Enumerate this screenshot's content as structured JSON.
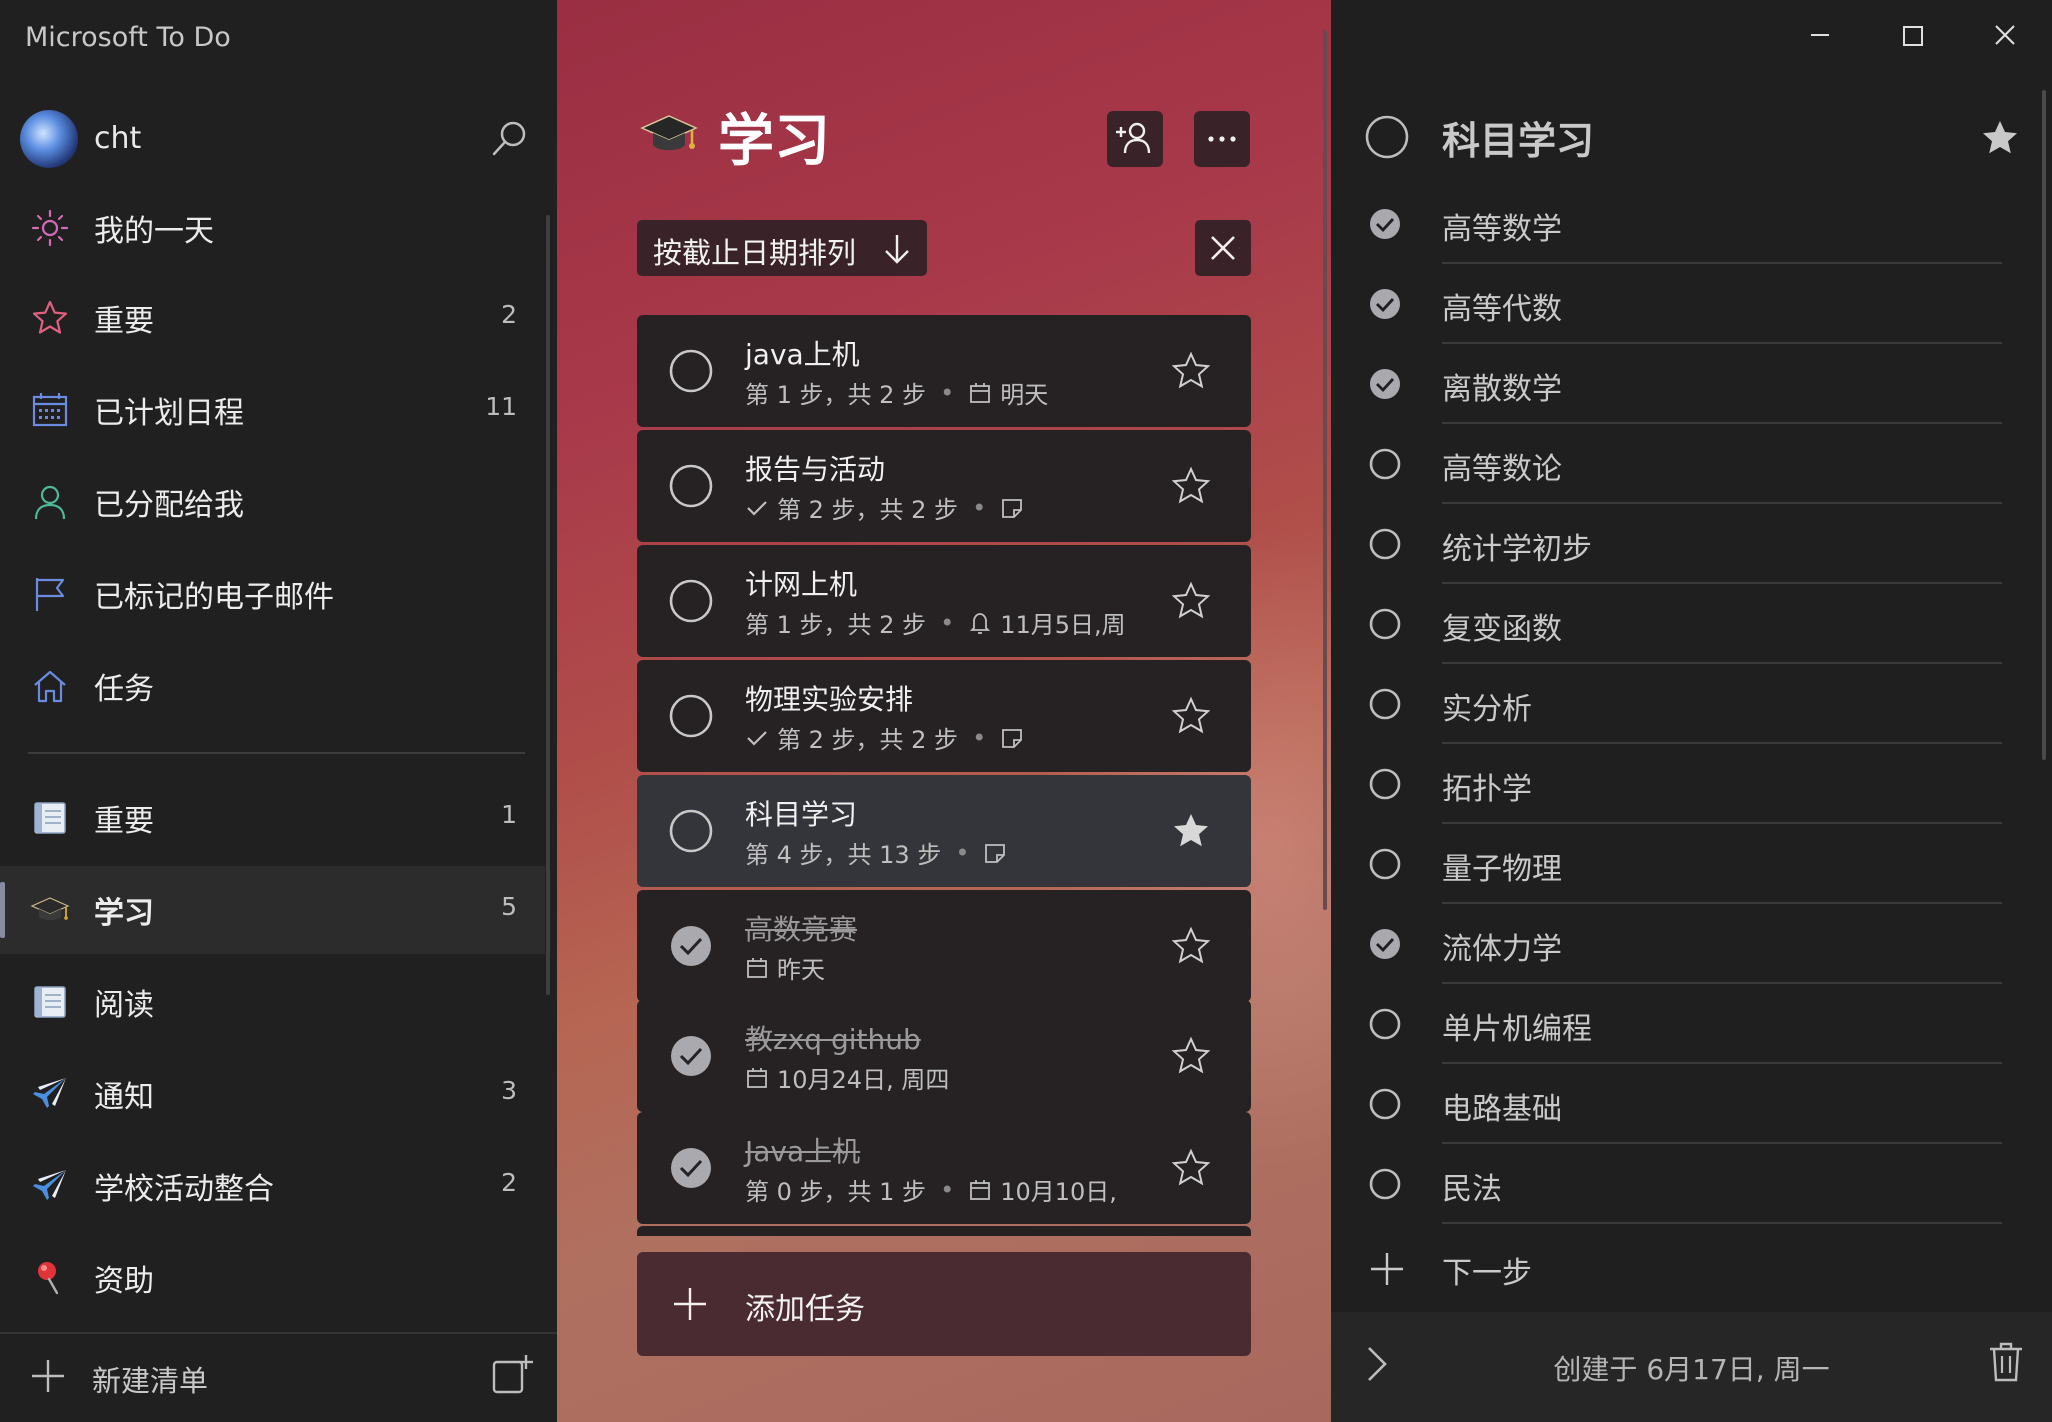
{
  "app_title": "Microsoft To Do",
  "user": {
    "name": "cht"
  },
  "nav": {
    "smart_lists": [
      {
        "label": "我的一天",
        "count": "",
        "icon": "sun-icon"
      },
      {
        "label": "重要",
        "count": "2",
        "icon": "star-outline-icon"
      },
      {
        "label": "已计划日程",
        "count": "11",
        "icon": "calendar-grid-icon"
      },
      {
        "label": "已分配给我",
        "count": "",
        "icon": "person-icon"
      },
      {
        "label": "已标记的电子邮件",
        "count": "",
        "icon": "flag-icon"
      },
      {
        "label": "任务",
        "count": "",
        "icon": "home-icon"
      }
    ],
    "custom_lists": [
      {
        "label": "重要",
        "count": "1",
        "icon": "notebook-icon"
      },
      {
        "label": "学习",
        "count": "5",
        "icon": "graduation-cap-icon",
        "active": true
      },
      {
        "label": "阅读",
        "count": "",
        "icon": "notebook-icon"
      },
      {
        "label": "通知",
        "count": "3",
        "icon": "airplane-icon"
      },
      {
        "label": "学校活动整合",
        "count": "2",
        "icon": "airplane-icon"
      },
      {
        "label": "资助",
        "count": "",
        "icon": "pushpin-icon"
      }
    ],
    "new_list_label": "新建清单"
  },
  "list": {
    "title": "学习",
    "sort_label": "按截止日期排列",
    "add_task_label": "添加任务",
    "tasks": [
      {
        "name": "java上机",
        "done": false,
        "starred": false,
        "steps": "第 1 步，共 2 步",
        "steps_checked": false,
        "extra_icon": "calendar-icon",
        "extra_text": "明天"
      },
      {
        "name": "报告与活动",
        "done": false,
        "starred": false,
        "steps": "第 2 步，共 2 步",
        "steps_checked": true,
        "extra_icon": "note-icon",
        "extra_text": ""
      },
      {
        "name": "计网上机",
        "done": false,
        "starred": false,
        "steps": "第 1 步，共 2 步",
        "steps_checked": false,
        "extra_icon": "bell-icon",
        "extra_text": "11月5日,周"
      },
      {
        "name": "物理实验安排",
        "done": false,
        "starred": false,
        "steps": "第 2 步，共 2 步",
        "steps_checked": true,
        "extra_icon": "note-icon",
        "extra_text": ""
      },
      {
        "name": "科目学习",
        "done": false,
        "starred": true,
        "selected": true,
        "steps": "第 4 步，共 13 步",
        "steps_checked": false,
        "extra_icon": "note-icon",
        "extra_text": ""
      },
      {
        "name": "高数竞赛",
        "done": true,
        "starred": false,
        "steps": "",
        "steps_checked": false,
        "extra_icon": "calendar-icon",
        "extra_text": "昨天"
      },
      {
        "name": "教zxq github",
        "done": true,
        "starred": false,
        "steps": "",
        "steps_checked": false,
        "extra_icon": "calendar-icon",
        "extra_text": "10月24日, 周四"
      },
      {
        "name": "Java上机",
        "done": true,
        "starred": false,
        "steps": "第 0 步，共 1 步",
        "steps_checked": false,
        "extra_icon": "calendar-icon",
        "extra_text": "10月10日,"
      }
    ]
  },
  "detail": {
    "title": "科目学习",
    "starred": true,
    "steps": [
      {
        "label": "高等数学",
        "done": true
      },
      {
        "label": "高等代数",
        "done": true
      },
      {
        "label": "离散数学",
        "done": true
      },
      {
        "label": "高等数论",
        "done": false
      },
      {
        "label": "统计学初步",
        "done": false
      },
      {
        "label": "复变函数",
        "done": false
      },
      {
        "label": "实分析",
        "done": false
      },
      {
        "label": "拓扑学",
        "done": false
      },
      {
        "label": "量子物理",
        "done": false
      },
      {
        "label": "流体力学",
        "done": true
      },
      {
        "label": "单片机编程",
        "done": false
      },
      {
        "label": "电路基础",
        "done": false
      },
      {
        "label": "民法",
        "done": false
      }
    ],
    "next_step_label": "下一步",
    "created_text": "创建于 6月17日, 周一"
  },
  "colors": {
    "sidebar_bg": "#202020",
    "detail_bg": "#1f1f1f",
    "task_bg": "#262123",
    "accent_sun": "#d46ab8",
    "accent_star": "#e06080",
    "accent_blue": "#6a8be0",
    "accent_green": "#4fb89a",
    "check_fill": "#a9a9ae"
  }
}
